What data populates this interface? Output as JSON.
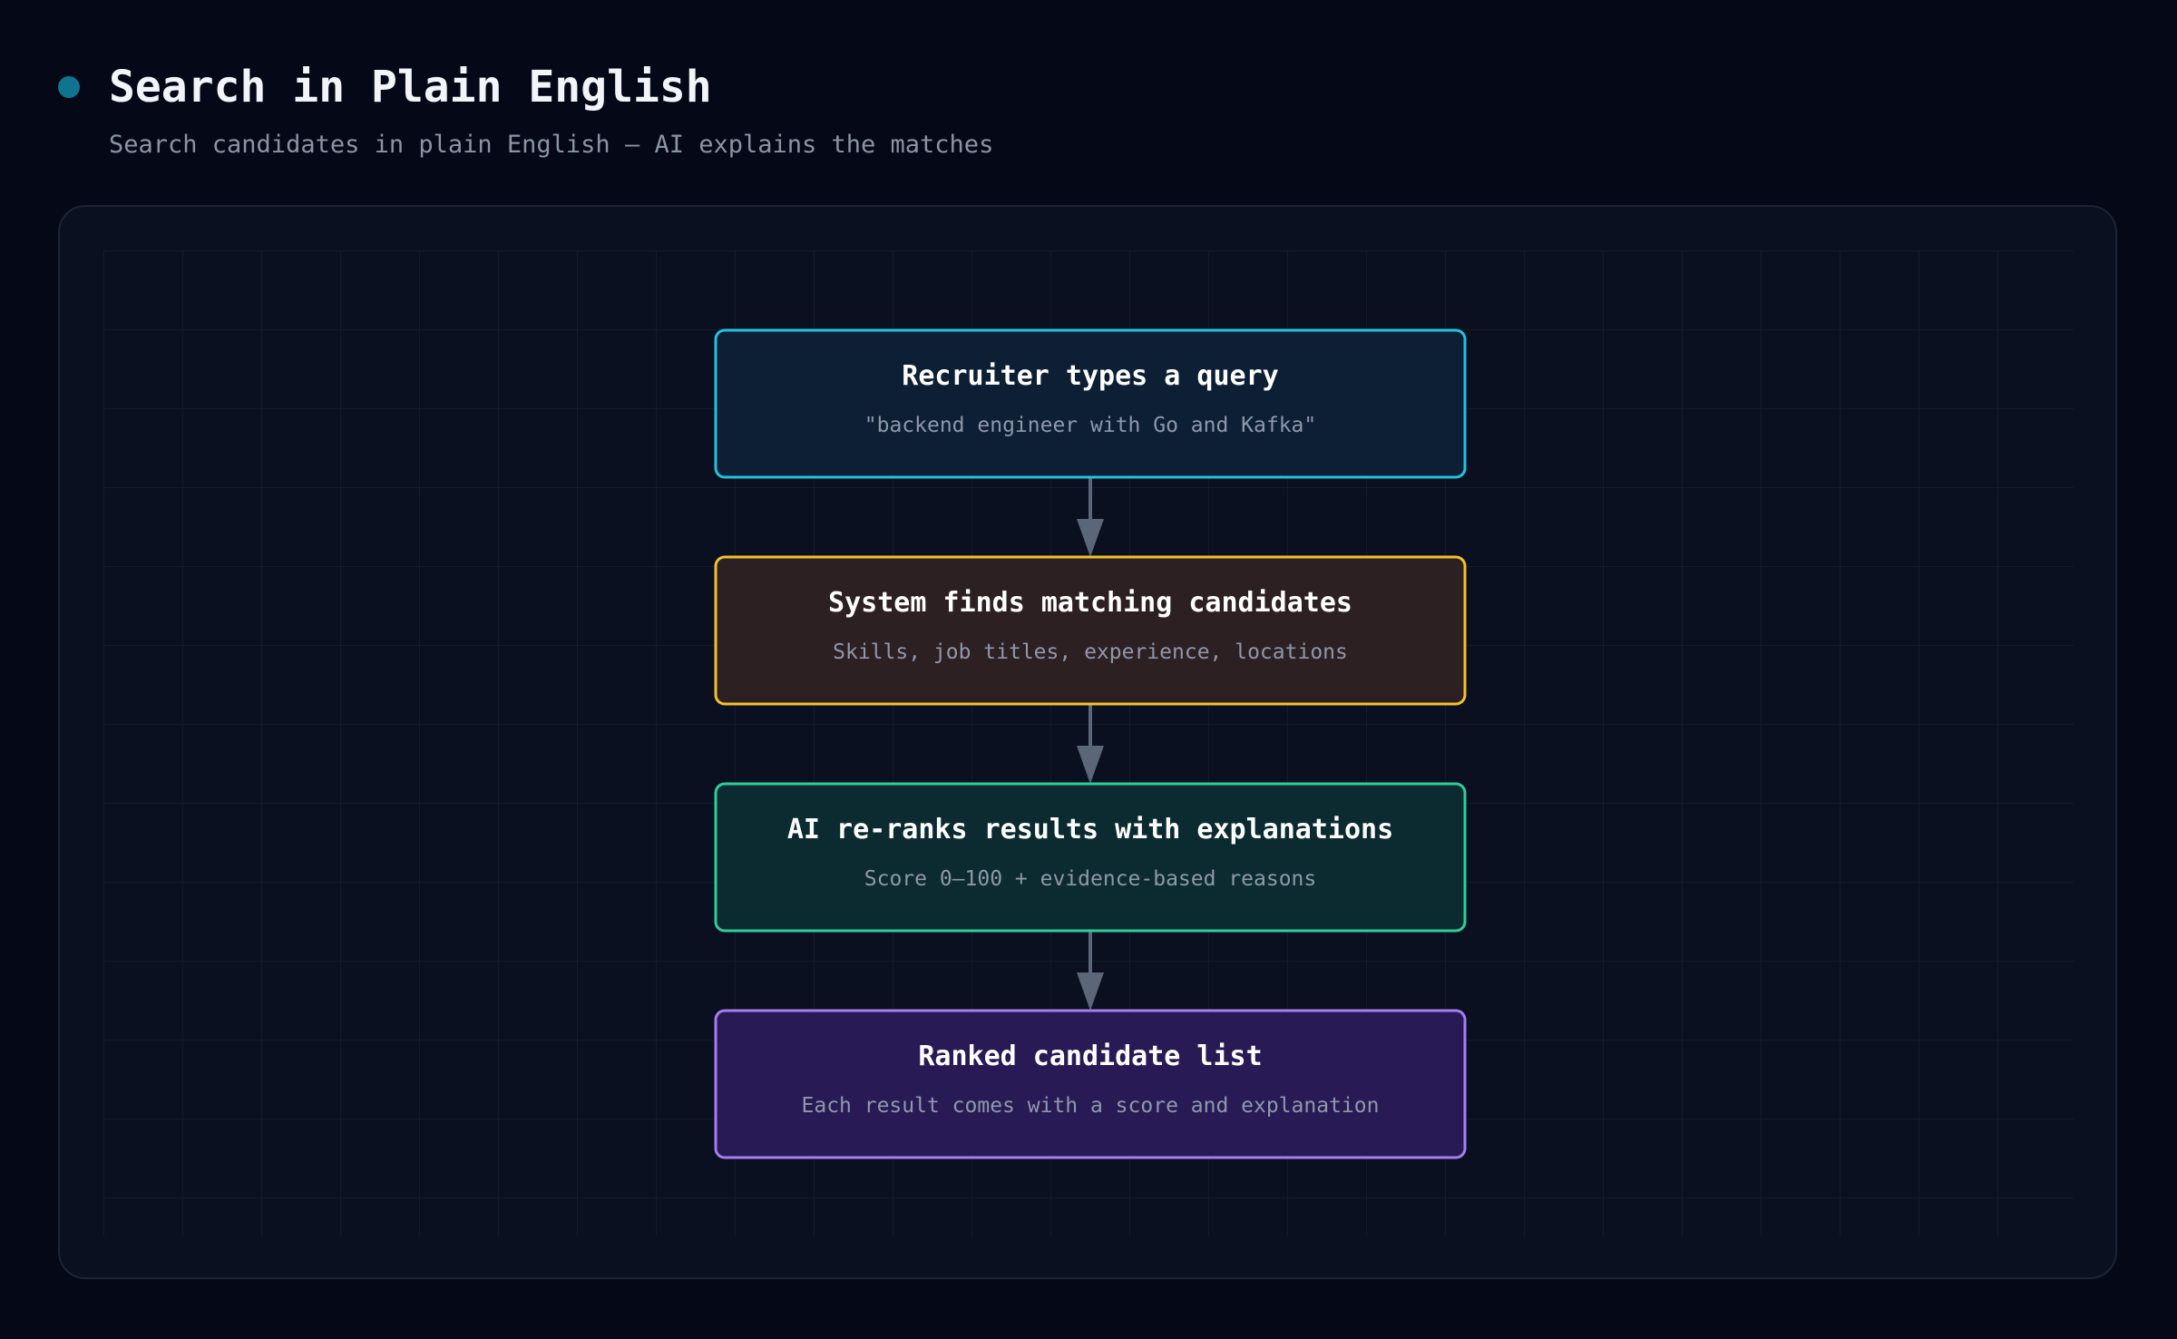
{
  "header": {
    "title": "Search in Plain English",
    "subtitle": "Search candidates in plain English — AI explains the matches"
  },
  "colors": {
    "background": "#050816",
    "panel": "#0a1020",
    "title_dot": "#0e7490",
    "arrow": "#5b6678"
  },
  "diagram": {
    "nodes": [
      {
        "id": "query",
        "title": "Recruiter types a query",
        "subtitle": "\"backend engineer with Go and Kafka\"",
        "border": "#22c3dd",
        "fill": "#0c1f35"
      },
      {
        "id": "match",
        "title": "System finds matching candidates",
        "subtitle": "Skills, job titles, experience, locations",
        "border": "#f5c02c",
        "fill": "#2c2023"
      },
      {
        "id": "rerank",
        "title": "AI re-ranks results with explanations",
        "subtitle": "Score 0–100 + evidence-based reasons",
        "border": "#2ecf9a",
        "fill": "#0b2b30"
      },
      {
        "id": "ranked",
        "title": "Ranked candidate list",
        "subtitle": "Each result comes with a score and explanation",
        "border": "#a77ef0",
        "fill": "#281b55"
      }
    ],
    "edges": [
      {
        "from": "query",
        "to": "match"
      },
      {
        "from": "match",
        "to": "rerank"
      },
      {
        "from": "rerank",
        "to": "ranked"
      }
    ]
  }
}
